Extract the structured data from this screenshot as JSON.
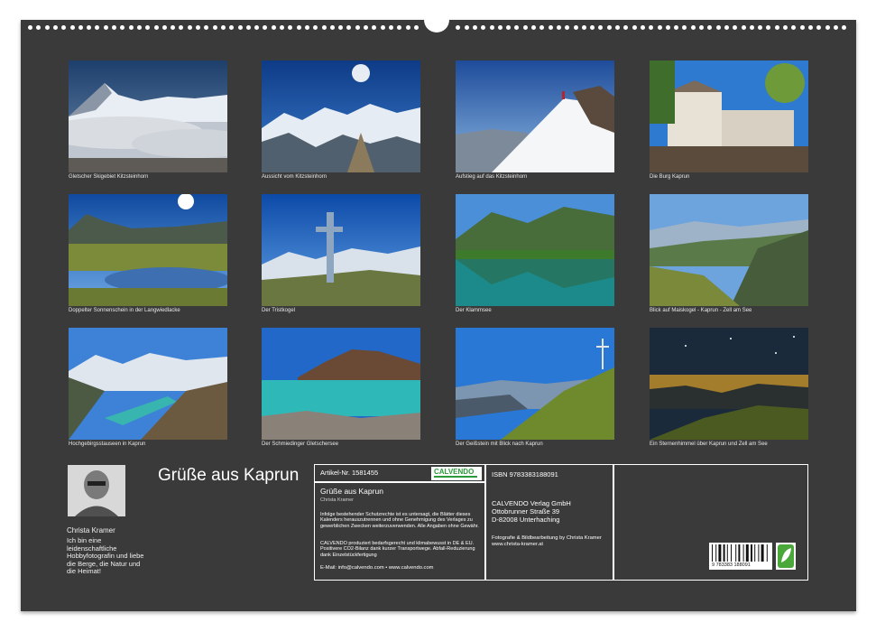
{
  "tiles": [
    {
      "caption": "Gletscher Skigebiet Kitzsteinhorn"
    },
    {
      "caption": "Aussicht vom Kitzsteinhorn"
    },
    {
      "caption": "Aufstieg auf das Kitzsteinhorn"
    },
    {
      "caption": "Die Burg Kaprun"
    },
    {
      "caption": "Doppelter Sonnenschein in der Langwiedlacke"
    },
    {
      "caption": "Der Tristkogel"
    },
    {
      "caption": "Der Klammsee"
    },
    {
      "caption": "Blick auf Maiskogel - Kaprun - Zell am See"
    },
    {
      "caption": "Hochgebirgsstauseen in Kaprun"
    },
    {
      "caption": "Der Schmiedinger Gletschersee"
    },
    {
      "caption": "Der Geißstein mit Blick nach Kaprun"
    },
    {
      "caption": "Ein Sternenhimmel über Kaprun und Zell am See"
    }
  ],
  "author": {
    "name": "Christa Kramer",
    "bio": "Ich bin eine leidenschaftliche Hobbyfotografin und liebe die Berge, die Natur und die Heimat!"
  },
  "calendar_title": "Grüße aus Kaprun",
  "info": {
    "article_no": "Artikel-Nr. 1581455",
    "brand": "CALVENDO",
    "title": "Grüße aus Kaprun",
    "author": "Christa Kramer",
    "legal1": "Infolge bestehender Schutzrechte ist es untersagt, die Blätter dieses Kalenders herauszutrennen und ohne Genehmigung des Verlages zu gewerblichen Zwecken weiterzuverwenden. Alle Angaben ohne Gewähr.",
    "legal2": "CALVENDO produziert bedarfsgerecht und klimabewusst in DE & EU. Positivere CO2-Bilanz dank kurzer Transportwege. Abfall-Reduzierung dank Einzelstückfertigung",
    "contact": "E-Mail: info@calvendo.com • www.calvendo.com",
    "isbn": "ISBN 9783383188091",
    "publisher": [
      "CALVENDO Verlag GmbH",
      "Ottobrunner Straße 39",
      "D-82008 Unterhaching"
    ],
    "credits": "Fotografie & Bildbearbeitung by Christa Kramer www.christa-kramer.at",
    "barcode_digits": "9 783383 188091"
  }
}
